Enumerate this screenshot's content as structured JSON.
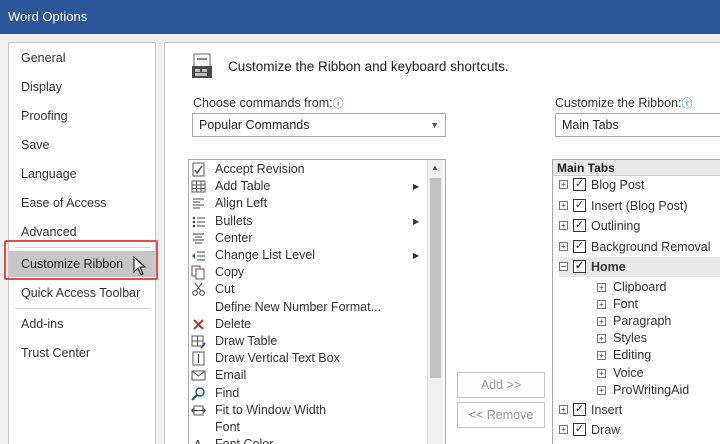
{
  "window": {
    "title": "Word Options"
  },
  "nav": {
    "items": [
      "General",
      "Display",
      "Proofing",
      "Save",
      "Language",
      "Ease of Access",
      "Advanced",
      "Customize Ribbon",
      "Quick Access Toolbar",
      "Add-ins",
      "Trust Center"
    ],
    "selected": "Customize Ribbon"
  },
  "header": {
    "text": "Customize the Ribbon and keyboard shortcuts."
  },
  "choose": {
    "label": "Choose commands from:",
    "value": "Popular Commands",
    "commands": [
      {
        "label": "Accept Revision",
        "icon": "accept-revision-icon",
        "submenu": false
      },
      {
        "label": "Add Table",
        "icon": "table-icon",
        "submenu": true
      },
      {
        "label": "Align Left",
        "icon": "align-left-icon",
        "submenu": false
      },
      {
        "label": "Bullets",
        "icon": "bullets-icon",
        "submenu": true
      },
      {
        "label": "Center",
        "icon": "center-icon",
        "submenu": false
      },
      {
        "label": "Change List Level",
        "icon": "list-level-icon",
        "submenu": true
      },
      {
        "label": "Copy",
        "icon": "copy-icon",
        "submenu": false
      },
      {
        "label": "Cut",
        "icon": "cut-icon",
        "submenu": false
      },
      {
        "label": "Define New Number Format...",
        "icon": "",
        "submenu": false
      },
      {
        "label": "Delete",
        "icon": "delete-icon",
        "submenu": false
      },
      {
        "label": "Draw Table",
        "icon": "draw-table-icon",
        "submenu": false
      },
      {
        "label": "Draw Vertical Text Box",
        "icon": "text-box-icon",
        "submenu": false
      },
      {
        "label": "Email",
        "icon": "email-icon",
        "submenu": false
      },
      {
        "label": "Find",
        "icon": "find-icon",
        "submenu": false
      },
      {
        "label": "Fit to Window Width",
        "icon": "fit-width-icon",
        "submenu": false
      },
      {
        "label": "Font",
        "icon": "",
        "submenu": false
      },
      {
        "label": "Font Color",
        "icon": "font-color-icon",
        "submenu": false
      }
    ]
  },
  "buttons": {
    "add": "Add >>",
    "remove": "<< Remove"
  },
  "ribbon": {
    "label": "Customize the Ribbon:",
    "value": "Main Tabs",
    "list_header": "Main Tabs",
    "tabs": [
      {
        "label": "Blog Post",
        "expand": "⊞",
        "checked": true
      },
      {
        "label": "Insert (Blog Post)",
        "expand": "⊞",
        "checked": true
      },
      {
        "label": "Outlining",
        "expand": "⊞",
        "checked": true
      },
      {
        "label": "Background Removal",
        "expand": "⊞",
        "checked": true
      },
      {
        "label": "Home",
        "expand": "⊟",
        "checked": true
      },
      {
        "label": "Insert",
        "expand": "⊞",
        "checked": true
      },
      {
        "label": "Draw",
        "expand": "⊞",
        "checked": true
      }
    ],
    "home_groups": [
      "Clipboard",
      "Font",
      "Paragraph",
      "Styles",
      "Editing",
      "Voice",
      "ProWritingAid"
    ]
  },
  "colors": {
    "titlebar": "#2b579a",
    "selected_nav": "#c6c6c6",
    "highlight_outline": "#e34a4a"
  }
}
